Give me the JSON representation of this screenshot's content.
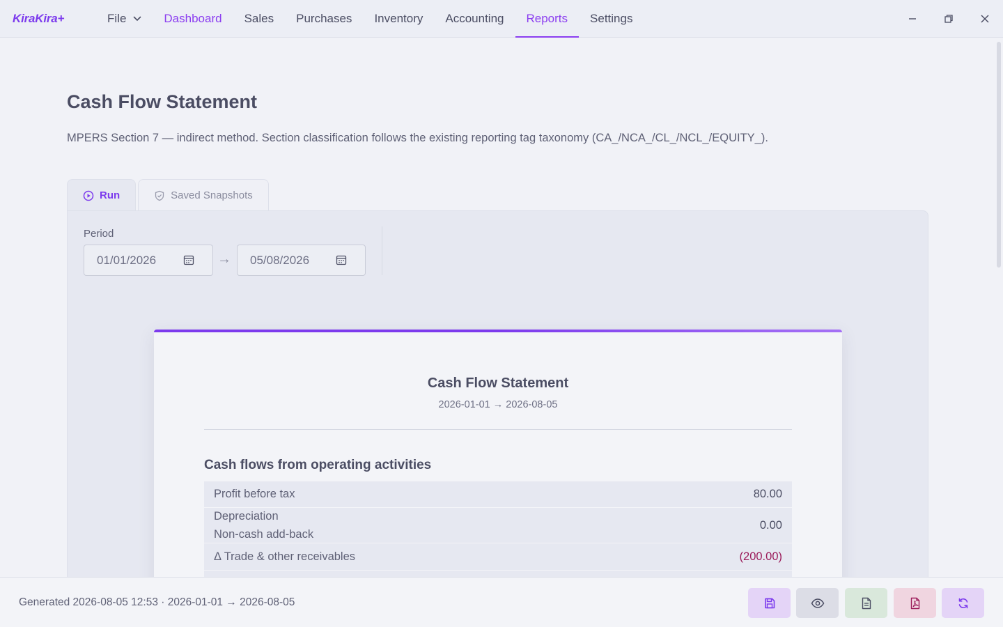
{
  "app": {
    "brand": "KiraKira+"
  },
  "menu": {
    "file": "File",
    "items": [
      "Dashboard",
      "Sales",
      "Purchases",
      "Inventory",
      "Accounting",
      "Reports",
      "Settings"
    ],
    "selected": "Reports"
  },
  "page": {
    "title": "Cash Flow Statement",
    "description": "MPERS Section 7 — indirect method. Section classification follows the existing reporting tag taxonomy (CA_/NCA_/CL_/NCL_/EQUITY_)."
  },
  "tabs": {
    "run": "Run",
    "snapshots": "Saved Snapshots"
  },
  "filters": {
    "period_label": "Period",
    "date_from": "01/01/2026",
    "date_to": "05/08/2026",
    "separator": "→"
  },
  "report": {
    "title": "Cash Flow Statement",
    "subtitle": "2026-01-01 → 2026-08-05",
    "section_operating": "Cash flows from operating activities",
    "rows": {
      "profit_label": "Profit before tax",
      "profit_value": "80.00",
      "depreciation_label": "Depreciation",
      "depreciation_sub": "Non-cash add-back",
      "depreciation_value": "0.00",
      "receivables_label": "Δ Trade & other receivables",
      "receivables_value": "(200.00)"
    }
  },
  "footer": {
    "generated": "Generated 2026-08-05 12:53 · 2026-01-01 → 2026-08-05"
  },
  "colors": {
    "accent": "#8b3df0",
    "negative": "#9b1b5a",
    "save_bg": "#e4d4f7",
    "preview_bg": "#dcdde6",
    "csv_bg": "#d9e8db",
    "pdf_bg": "#f0d5e0",
    "refresh_bg": "#e4d4f7"
  }
}
